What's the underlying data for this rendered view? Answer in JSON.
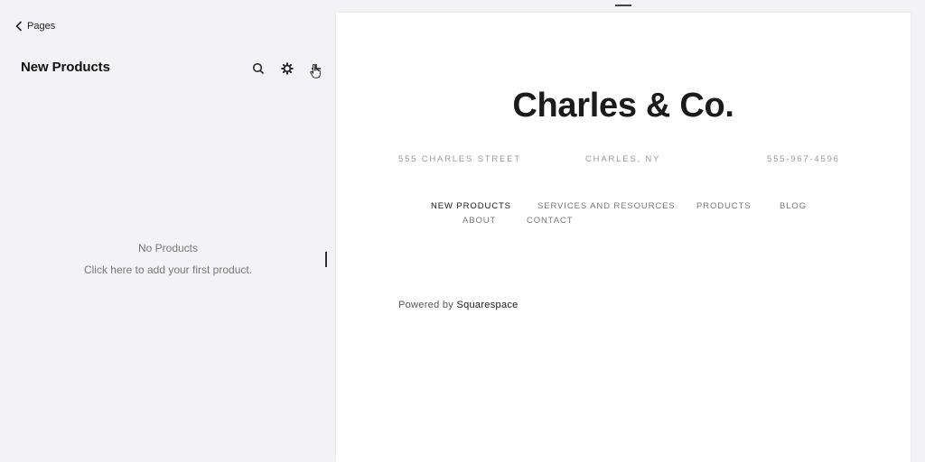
{
  "left_panel": {
    "back_label": "Pages",
    "title": "New Products",
    "tools": {
      "search_icon": "search-icon",
      "settings_icon": "gear-icon",
      "add_icon": "plus-icon"
    },
    "empty_state": {
      "title": "No Products",
      "action": "Click here to add your first product."
    }
  },
  "preview": {
    "site_title": "Charles & Co.",
    "address": "555 CHARLES STREET",
    "city": "CHARLES, NY",
    "phone": "555-967-4596",
    "nav": [
      {
        "label": "NEW PRODUCTS",
        "active": true
      },
      {
        "label": "SERVICES AND RESOURCES",
        "active": false
      },
      {
        "label": "PRODUCTS",
        "active": false
      },
      {
        "label": "BLOG",
        "active": false
      },
      {
        "label": "ABOUT",
        "active": false
      },
      {
        "label": "CONTACT",
        "active": false
      }
    ],
    "powered_prefix": "Powered by",
    "powered_brand": "Squarespace"
  },
  "colors": {
    "panel_bg": "#f3f3f5",
    "preview_bg": "#ffffff",
    "muted_text": "#9a9a9a",
    "title_text": "#1b1b1b"
  }
}
